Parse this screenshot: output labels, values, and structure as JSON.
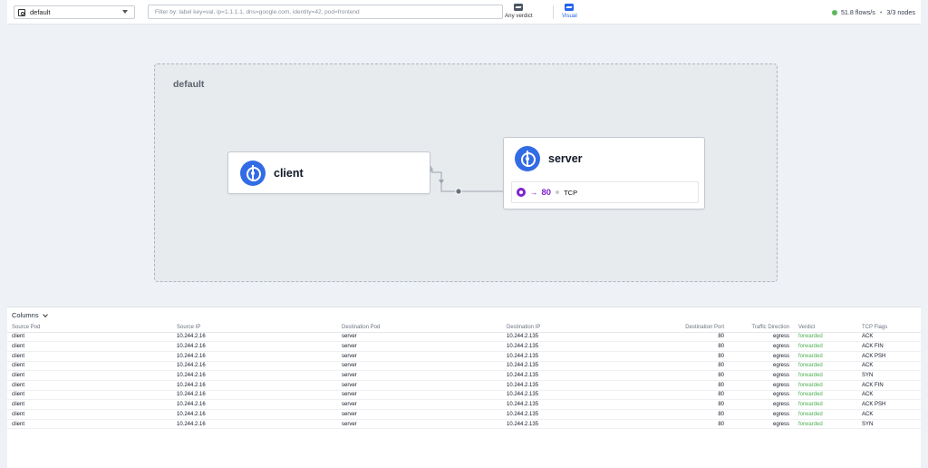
{
  "topbar": {
    "namespace": "default",
    "filter_placeholder": "Filter by: label key=val, ip=1.1.1.1, dns=google.com, identity=42, pod=frontend",
    "verdict_label": "Any verdict",
    "visual_label": "Visual",
    "flow_rate": "51.8 flows/s",
    "separator": "•",
    "nodes": "3/3 nodes",
    "status_color": "#5cb85c"
  },
  "map": {
    "namespace_label": "default",
    "client": {
      "name": "client"
    },
    "server": {
      "name": "server",
      "port_arrow": "→",
      "port": "80",
      "protocol": "TCP"
    }
  },
  "flows": {
    "columns_label": "Columns",
    "headers": [
      "Source Pod",
      "Source IP",
      "Destination Pod",
      "Destination IP",
      "Destination Port",
      "Traffic Direction",
      "Verdict",
      "TCP Flags"
    ],
    "rows": [
      [
        "client",
        "10.244.2.16",
        "server",
        "10.244.2.135",
        "80",
        "egress",
        "forwarded",
        "ACK"
      ],
      [
        "client",
        "10.244.2.16",
        "server",
        "10.244.2.135",
        "80",
        "egress",
        "forwarded",
        "ACK FIN"
      ],
      [
        "client",
        "10.244.2.16",
        "server",
        "10.244.2.135",
        "80",
        "egress",
        "forwarded",
        "ACK PSH"
      ],
      [
        "client",
        "10.244.2.16",
        "server",
        "10.244.2.135",
        "80",
        "egress",
        "forwarded",
        "ACK"
      ],
      [
        "client",
        "10.244.2.16",
        "server",
        "10.244.2.135",
        "80",
        "egress",
        "forwarded",
        "SYN"
      ],
      [
        "client",
        "10.244.2.16",
        "server",
        "10.244.2.135",
        "80",
        "egress",
        "forwarded",
        "ACK FIN"
      ],
      [
        "client",
        "10.244.2.16",
        "server",
        "10.244.2.135",
        "80",
        "egress",
        "forwarded",
        "ACK"
      ],
      [
        "client",
        "10.244.2.16",
        "server",
        "10.244.2.135",
        "80",
        "egress",
        "forwarded",
        "ACK PSH"
      ],
      [
        "client",
        "10.244.2.16",
        "server",
        "10.244.2.135",
        "80",
        "egress",
        "forwarded",
        "ACK"
      ],
      [
        "client",
        "10.244.2.16",
        "server",
        "10.244.2.135",
        "80",
        "egress",
        "forwarded",
        "SYN"
      ]
    ],
    "verdict_color": "#4caf50"
  }
}
